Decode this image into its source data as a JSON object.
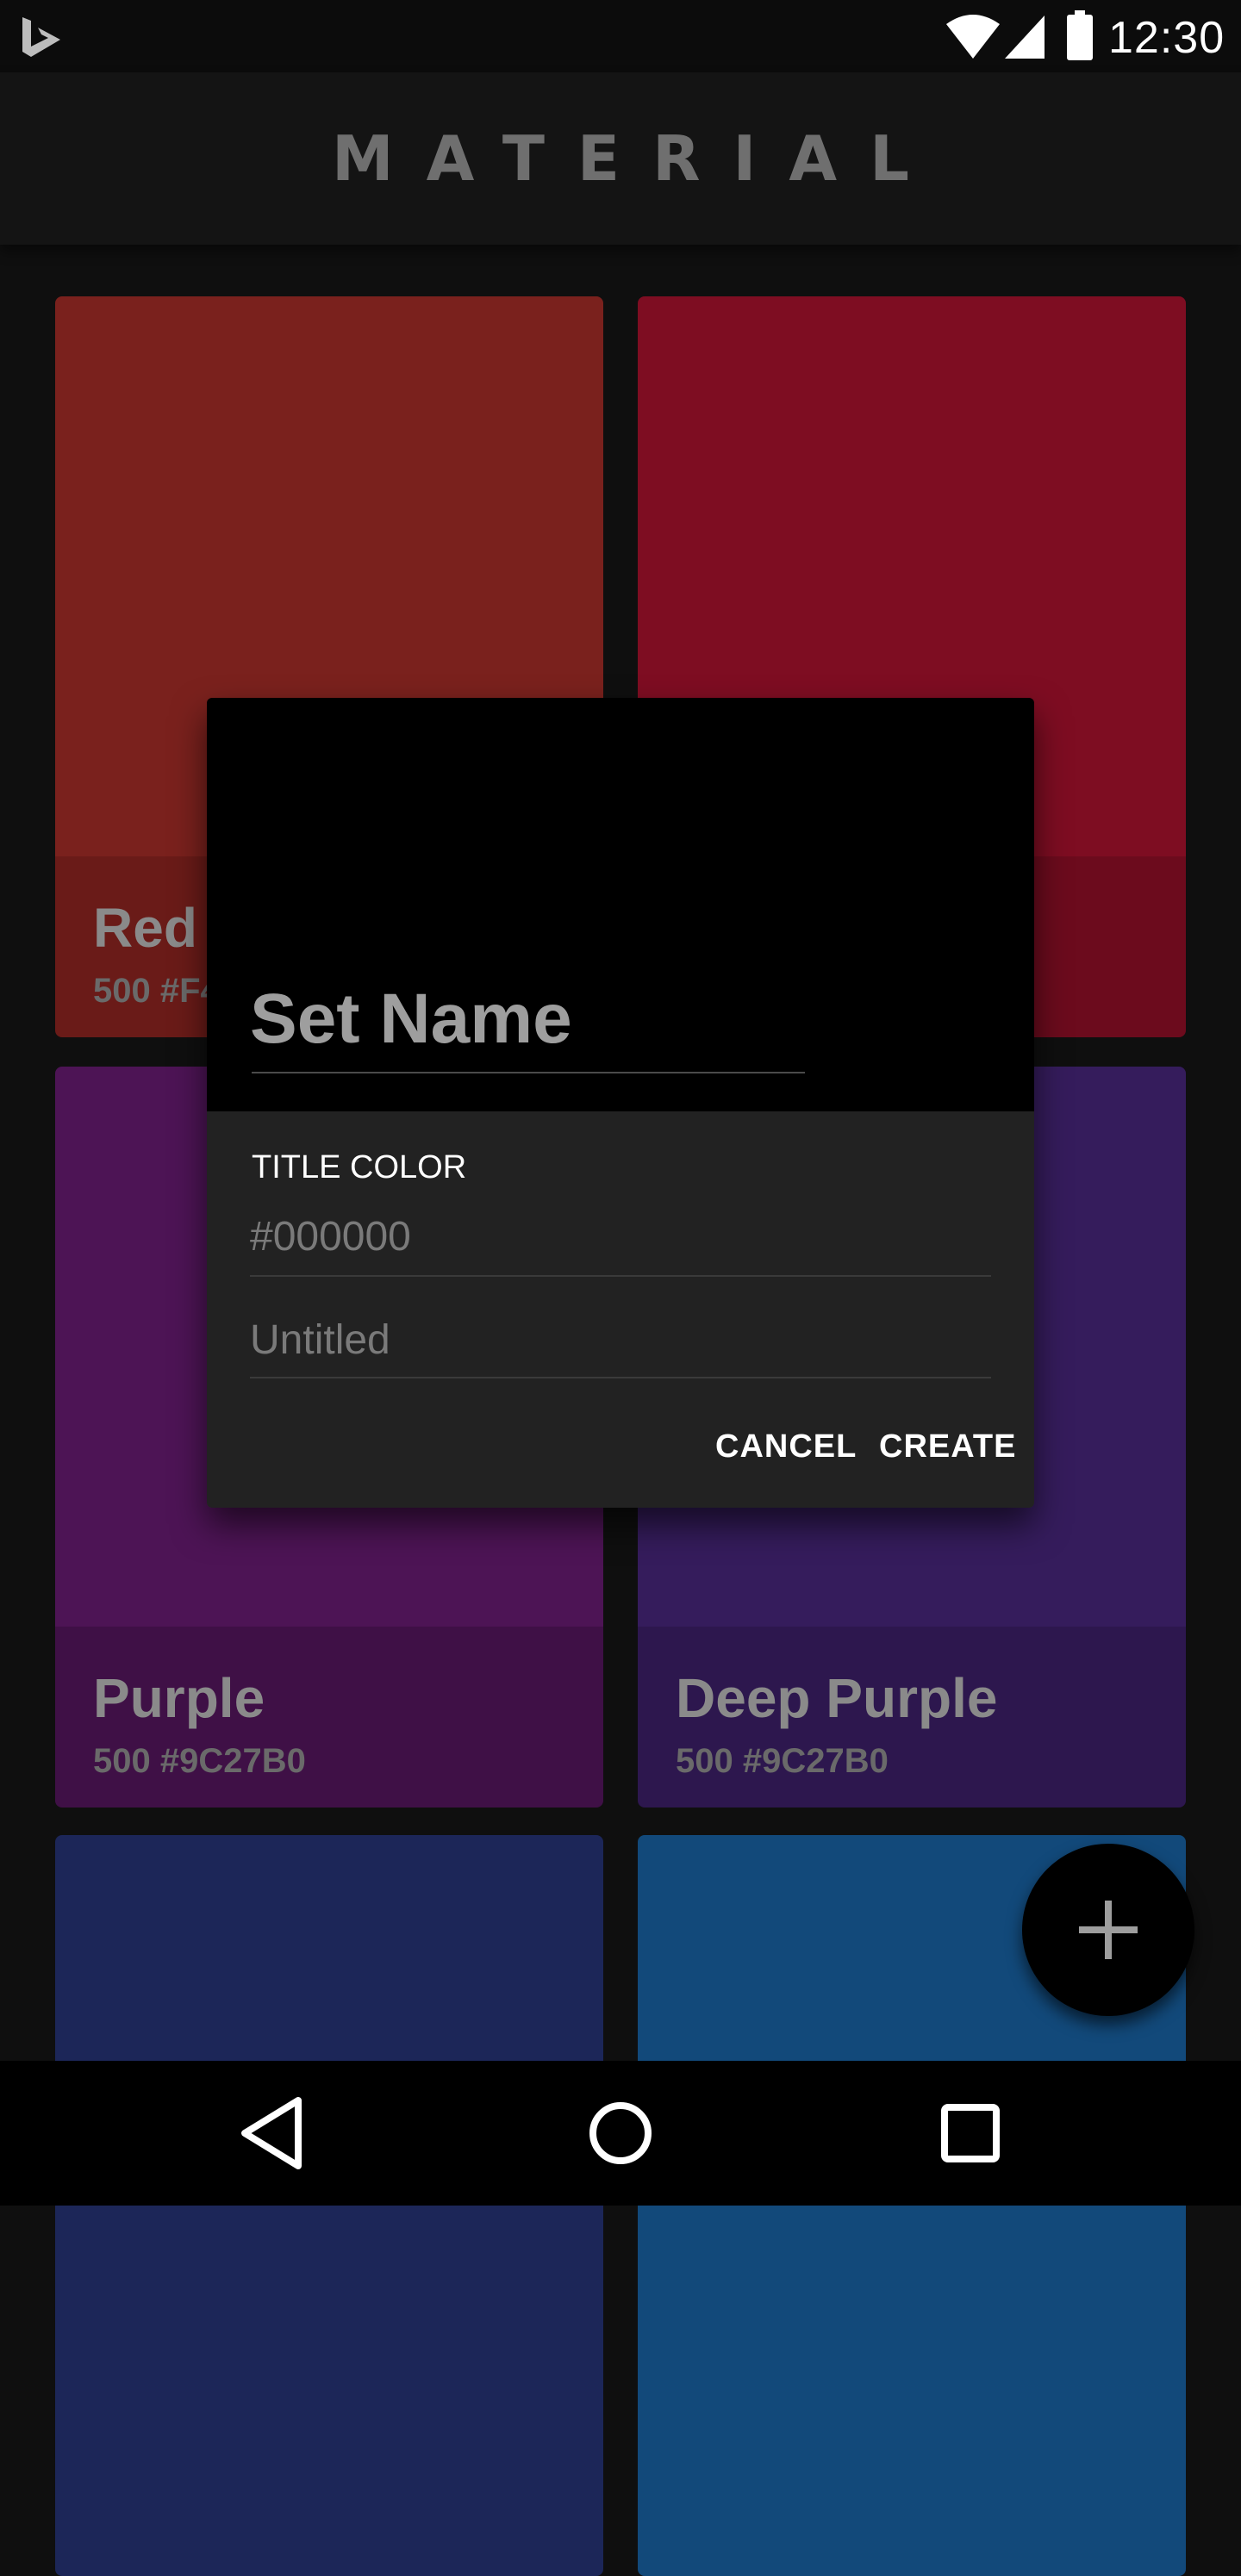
{
  "status_bar": {
    "time": "12:30",
    "icons": [
      "bing-logo-icon",
      "wifi-icon",
      "cell-signal-icon",
      "battery-icon"
    ]
  },
  "app_bar": {
    "title": "MATERIAL"
  },
  "cards": [
    {
      "name": "Red",
      "code": "500 #F4",
      "top_color": "#7a211d",
      "bottom_color": "#6a1b18"
    },
    {
      "name": "",
      "code": "",
      "top_color": "#7e0d22",
      "bottom_color": "#6c0b1d"
    },
    {
      "name": "Purple",
      "code": "500 #9C27B0",
      "top_color": "#4d1455",
      "bottom_color": "#3f1046"
    },
    {
      "name": "Deep Purple",
      "code": "500 #9C27B0",
      "top_color": "#351c5c",
      "bottom_color": "#2d174e"
    },
    {
      "name": "",
      "code": "",
      "top_color": "#1c2658",
      "bottom_color": "#1c2658"
    },
    {
      "name": "",
      "code": "",
      "top_color": "#12497a",
      "bottom_color": "#12497a"
    }
  ],
  "dialog": {
    "title_input_placeholder": "Set Name",
    "section_label": "TITLE COLOR",
    "color_value": "#000000",
    "name_placeholder": "Untitled",
    "cancel_label": "CANCEL",
    "create_label": "CREATE"
  },
  "fab": {
    "icon": "plus-icon"
  },
  "nav_bar": {
    "icons": [
      "back-icon",
      "home-icon",
      "recent-apps-icon"
    ]
  }
}
